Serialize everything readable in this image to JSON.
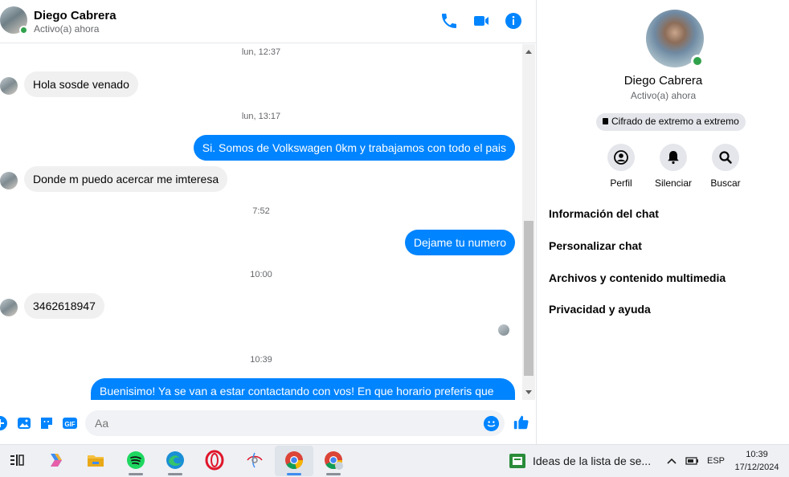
{
  "colors": {
    "accent": "#0084ff",
    "online": "#31a24c",
    "bubble_in": "#f0f0f0"
  },
  "header": {
    "name": "Diego Cabrera",
    "status": "Activo(a) ahora",
    "icons": [
      "phone-icon",
      "video-icon",
      "info-icon"
    ]
  },
  "messages": [
    {
      "type": "timestamp",
      "text": "lun, 12:37"
    },
    {
      "type": "in",
      "text": "Hola sosde venado"
    },
    {
      "type": "timestamp",
      "text": "lun, 13:17"
    },
    {
      "type": "out",
      "text": "Si. Somos de Volkswagen 0km y trabajamos con todo el pais"
    },
    {
      "type": "in",
      "text": "Donde m puedo acercar me imteresa"
    },
    {
      "type": "timestamp",
      "text": "7:52"
    },
    {
      "type": "out",
      "text": "Dejame tu numero"
    },
    {
      "type": "timestamp",
      "text": "10:00"
    },
    {
      "type": "in",
      "text": "3462618947"
    },
    {
      "type": "timestamp",
      "text": "10:39"
    },
    {
      "type": "out",
      "text": "Buenisimo! Ya se van a estar contactando con vos! En que horario preferis que se"
    }
  ],
  "composer": {
    "placeholder": "Aa",
    "icons": [
      "plus-icon",
      "image-icon",
      "sticker-icon",
      "gif-icon",
      "emoji-icon",
      "like-icon"
    ],
    "gif_label": "GIF"
  },
  "info_panel": {
    "name": "Diego Cabrera",
    "status": "Activo(a) ahora",
    "encryption": "Cifrado de extremo a extremo",
    "actions": [
      {
        "label": "Perfil",
        "icon": "profile-icon"
      },
      {
        "label": "Silenciar",
        "icon": "bell-icon"
      },
      {
        "label": "Buscar",
        "icon": "search-icon"
      }
    ],
    "menu": [
      "Información del chat",
      "Personalizar chat",
      "Archivos y contenido multimedia",
      "Privacidad y ayuda"
    ]
  },
  "taskbar": {
    "apps": [
      "task-view-icon",
      "copilot-icon",
      "file-explorer-icon",
      "spotify-icon",
      "edge-icon",
      "opera-icon",
      "app-icon",
      "chrome-icon",
      "chrome-profile-icon"
    ],
    "notification": "Ideas de la lista de se...",
    "language": "ESP",
    "time": "10:39",
    "date": "17/12/2024"
  }
}
